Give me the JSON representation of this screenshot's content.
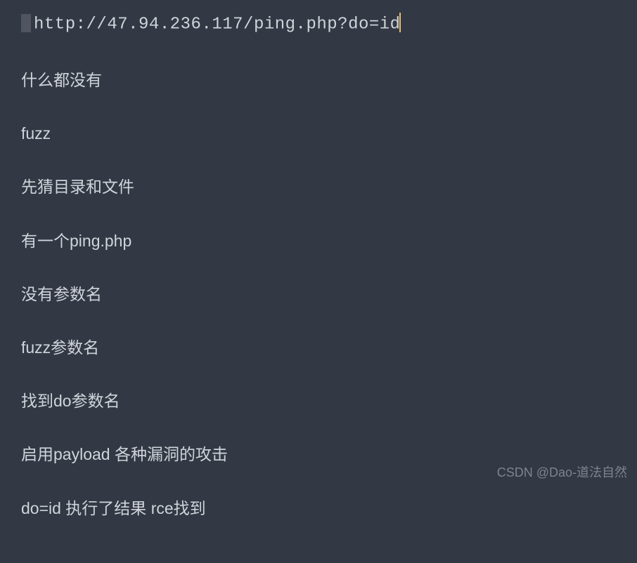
{
  "url": "http://47.94.236.117/ping.php?do=id",
  "lines": [
    "什么都没有",
    "fuzz",
    "先猜目录和文件",
    "有一个ping.php",
    "没有参数名",
    "fuzz参数名",
    "找到do参数名",
    "启用payload  各种漏洞的攻击",
    "do=id  执行了结果  rce找到"
  ],
  "watermark": "CSDN @Dao-道法自然"
}
